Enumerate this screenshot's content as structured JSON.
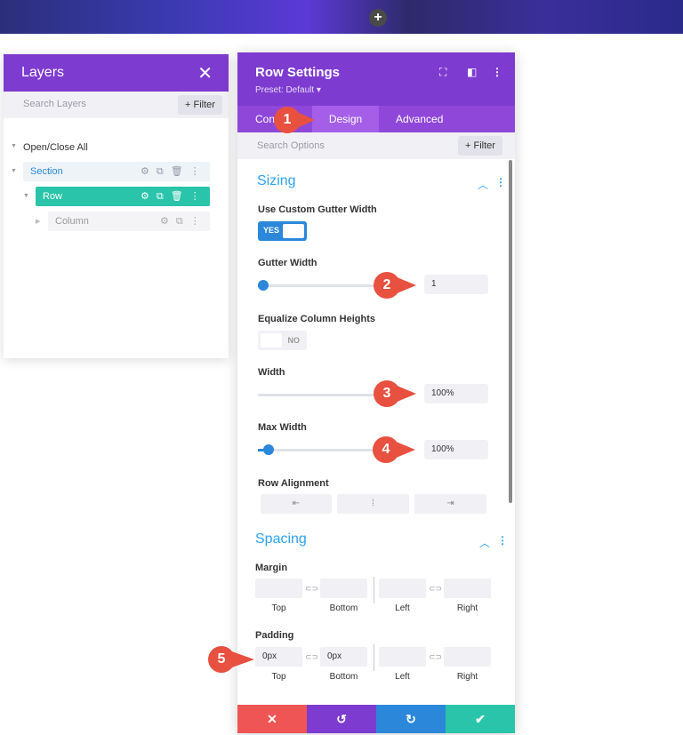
{
  "banner": {
    "add_icon": "plus-icon"
  },
  "layers": {
    "title": "Layers",
    "close_icon": "close-icon",
    "search_placeholder": "Search Layers",
    "filter_label": "+ Filter",
    "open_close_all": "Open/Close All",
    "items": [
      {
        "label": "Section"
      },
      {
        "label": "Row"
      },
      {
        "label": "Column"
      }
    ]
  },
  "settings": {
    "title": "Row Settings",
    "preset": "Preset: Default ▾",
    "tabs": [
      "Content",
      "Design",
      "Advanced"
    ],
    "tab_visible_content": "Con",
    "search_placeholder": "Search Options",
    "filter_label": "+ Filter",
    "sizing": {
      "title": "Sizing",
      "custom_gutter_label": "Use Custom Gutter Width",
      "custom_gutter_value": "YES",
      "gutter_width_label": "Gutter Width",
      "gutter_width_value": "1",
      "equalize_label": "Equalize Column Heights",
      "equalize_value": "NO",
      "width_label": "Width",
      "width_value": "100%",
      "max_width_label": "Max Width",
      "max_width_value": "100%",
      "row_alignment_label": "Row Alignment"
    },
    "spacing": {
      "title": "Spacing",
      "margin_label": "Margin",
      "padding_label": "Padding",
      "sub_labels": [
        "Top",
        "Bottom",
        "Left",
        "Right"
      ],
      "padding_top": "0px",
      "padding_bottom": "0px"
    }
  },
  "callouts": [
    "1",
    "2",
    "3",
    "4",
    "5"
  ],
  "colors": {
    "header_purple": "#7e3bd0",
    "accent_blue": "#2ea3f2",
    "teal": "#29c4a9",
    "callout_red": "#e8503f",
    "cancel_red": "#ef5555",
    "undo_purple": "#7e3bd0",
    "redo_blue": "#2b87da",
    "save_green": "#29c4a9"
  }
}
